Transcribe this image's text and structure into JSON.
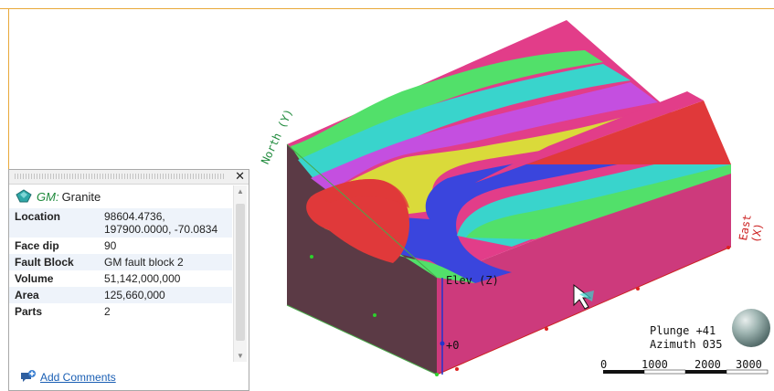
{
  "panel": {
    "title_prefix": "GM:",
    "title_name": "Granite",
    "close_symbol": "✕",
    "rows": [
      {
        "key": "Location",
        "value": "98604.4736, 197900.0000, -70.0834"
      },
      {
        "key": "Face dip",
        "value": "90"
      },
      {
        "key": "Fault Block",
        "value": "GM fault block 2"
      },
      {
        "key": "Volume",
        "value": "51,142,000,000"
      },
      {
        "key": "Area",
        "value": "125,660,000"
      },
      {
        "key": "Parts",
        "value": "2"
      }
    ],
    "add_comments": "Add Comments"
  },
  "scene": {
    "north_label": "North (Y)",
    "east_label": "East (X)",
    "elev_label": "Elev (Z)",
    "plus_zero": "+0",
    "plunge": "Plunge +41",
    "azimuth": "Azimuth 035",
    "scale": [
      "0",
      "1000",
      "2000",
      "3000"
    ],
    "colors": {
      "magenta": "#e23d89",
      "red": "#e0393a",
      "yellow": "#dada3a",
      "blue": "#3a45dd",
      "cyan": "#39d4cc",
      "green": "#52e06a",
      "violet": "#c44fe0",
      "side_dark": "#5b3a45",
      "side_front": "#c93a7a"
    }
  },
  "icons": {
    "granite": "gem-icon",
    "comments": "comment-add-icon",
    "view_sphere": "view-sphere-icon"
  }
}
